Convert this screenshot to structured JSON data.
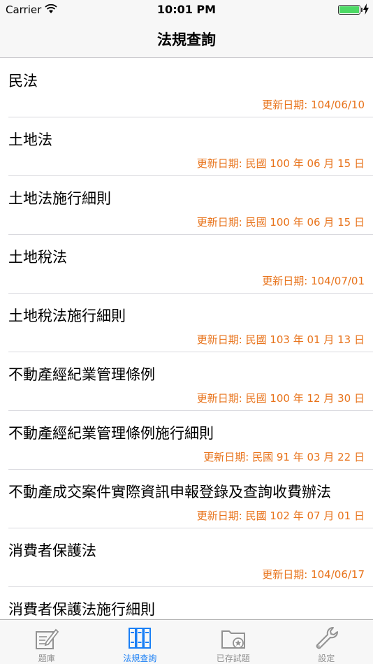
{
  "status_bar": {
    "carrier": "Carrier",
    "time": "10:01 PM",
    "battery_color": "#4cd964"
  },
  "nav": {
    "title": "法規查詢"
  },
  "laws": [
    {
      "name": "民法",
      "date": "更新日期: 104/06/10"
    },
    {
      "name": "土地法",
      "date": "更新日期: 民國 100 年 06 月 15 日"
    },
    {
      "name": "土地法施行細則",
      "date": "更新日期: 民國 100 年 06 月 15 日"
    },
    {
      "name": "土地稅法",
      "date": "更新日期: 104/07/01"
    },
    {
      "name": "土地稅法施行細則",
      "date": "更新日期: 民國 103 年 01 月 13 日"
    },
    {
      "name": "不動產經紀業管理條例",
      "date": "更新日期: 民國 100 年 12 月 30 日"
    },
    {
      "name": "不動產經紀業管理條例施行細則",
      "date": "更新日期: 民國 91 年 03 月 22 日"
    },
    {
      "name": "不動產成交案件實際資訊申報登錄及查詢收費辦法",
      "date": "更新日期: 民國 102 年 07 月 01 日"
    },
    {
      "name": "消費者保護法",
      "date": "更新日期: 104/06/17"
    },
    {
      "name": "消費者保護法施行細則",
      "date": ""
    }
  ],
  "tabs": [
    {
      "label": "題庫",
      "icon": "edit-note-icon",
      "active": false
    },
    {
      "label": "法規查詢",
      "icon": "binders-icon",
      "active": true
    },
    {
      "label": "已存試題",
      "icon": "folder-star-icon",
      "active": false
    },
    {
      "label": "設定",
      "icon": "wrench-icon",
      "active": false
    }
  ],
  "colors": {
    "date_text": "#e8731b",
    "active_tab": "#1a7ff5",
    "inactive_tab": "#929292"
  }
}
